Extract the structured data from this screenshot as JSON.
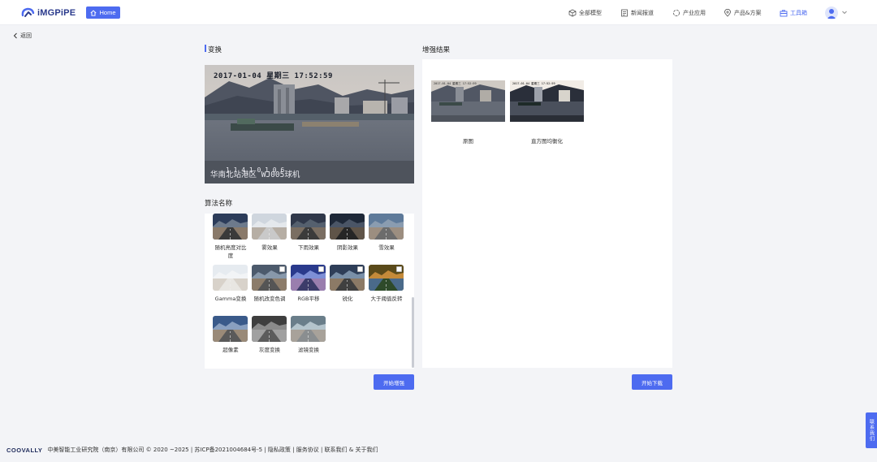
{
  "header": {
    "logo_text": "iMGPiPE",
    "home_label": "Home",
    "nav": [
      {
        "label": "全部模型",
        "icon": "cube-icon"
      },
      {
        "label": "新闻报道",
        "icon": "news-icon"
      },
      {
        "label": "产业应用",
        "icon": "industry-icon"
      },
      {
        "label": "产品&方案",
        "icon": "location-pin-icon"
      },
      {
        "label": "工具箱",
        "icon": "toolbox-icon",
        "active": true
      }
    ]
  },
  "back_label": "返回",
  "transform": {
    "title": "变换",
    "image_timestamp": "2017-01-04 星期三 17:52:59",
    "image_caption_a": "1 1 4 1 0 1 0 6",
    "image_caption_b": "华南北站港区 WJ005球机"
  },
  "algorithms": {
    "title": "算法名称",
    "items": [
      {
        "label": "随机亮度对比度",
        "checkbox": false
      },
      {
        "label": "雾效果",
        "checkbox": false
      },
      {
        "label": "下雨效果",
        "checkbox": false
      },
      {
        "label": "阴影效果",
        "checkbox": false
      },
      {
        "label": "雪效果",
        "checkbox": false
      },
      {
        "label": "Gamma变换",
        "checkbox": false
      },
      {
        "label": "随机改变色调",
        "checkbox": true
      },
      {
        "label": "RGB平移",
        "checkbox": true
      },
      {
        "label": "锐化",
        "checkbox": true
      },
      {
        "label": "大于阈值反转",
        "checkbox": true
      },
      {
        "label": "超像素",
        "checkbox": false
      },
      {
        "label": "灰度变换",
        "checkbox": false
      },
      {
        "label": "滤镜变换",
        "checkbox": false
      }
    ]
  },
  "results": {
    "title": "增强结果",
    "items": [
      {
        "label": "原图"
      },
      {
        "label": "直方图均衡化"
      }
    ]
  },
  "buttons": {
    "start_enhance": "开始增强",
    "start_download": "开始下载"
  },
  "contact_label": "联系我们",
  "footer": {
    "brand": "COOVALLY",
    "text": "中美智能工业研究院（南京）有限公司 © 2020 ~2025 | 苏ICP备2021004684号-5 | 隐私政策 | 服务协议 | 联系我们  &  关于我们"
  },
  "colors": {
    "accent": "#4d6bf0",
    "page_bg": "#f3f4f7"
  }
}
